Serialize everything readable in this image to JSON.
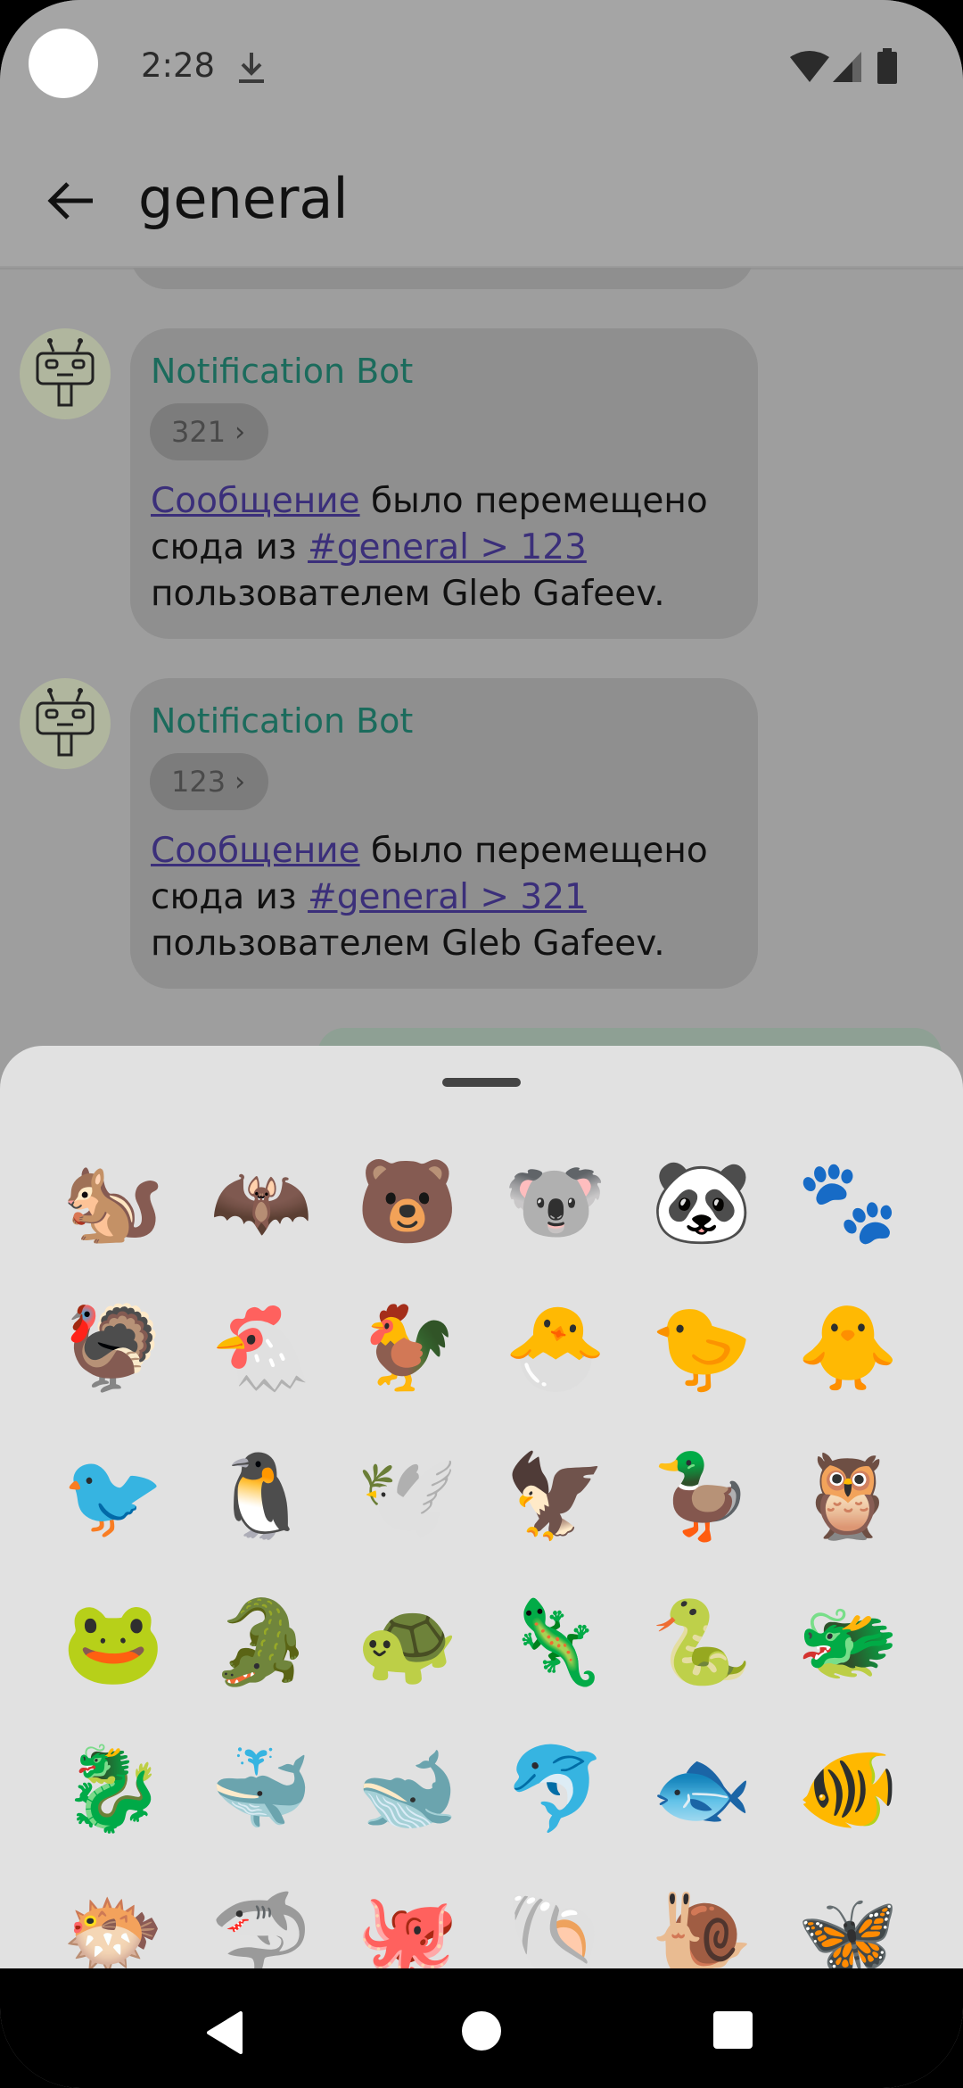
{
  "status_bar": {
    "time": "2:28"
  },
  "app_bar": {
    "title": "general"
  },
  "messages": [
    {
      "sender": "Notification Bot",
      "topic": "321",
      "link1": "Сообщение",
      "mid": " было перемещено сюда из ",
      "link2": "#general > 123",
      "tail": " пользователем Gleb Gafeev."
    },
    {
      "sender": "Notification Bot",
      "topic": "123",
      "link1": "Сообщение",
      "mid": " было перемещено сюда из ",
      "link2": "#general > 321",
      "tail": " пользователем Gleb Gafeev."
    }
  ],
  "emoji_sheet": {
    "rows": [
      [
        "🐿️",
        "🦇",
        "🐻",
        "🐨",
        "🐼",
        "🐾"
      ],
      [
        "🦃",
        "🐔",
        "🐓",
        "🐣",
        "🐤",
        "🐥"
      ],
      [
        "🐦",
        "🐧",
        "🕊️",
        "🦅",
        "🦆",
        "🦉"
      ],
      [
        "🐸",
        "🐊",
        "🐢",
        "🦎",
        "🐍",
        "🐲"
      ],
      [
        "🐉",
        "🐳",
        "🐋",
        "🐬",
        "🐟",
        "🐠"
      ],
      [
        "🐡",
        "🦈",
        "🐙",
        "🐚",
        "🐌",
        "🦋"
      ]
    ]
  },
  "nav_bar": {
    "back": "back",
    "home": "home",
    "recents": "recents"
  }
}
